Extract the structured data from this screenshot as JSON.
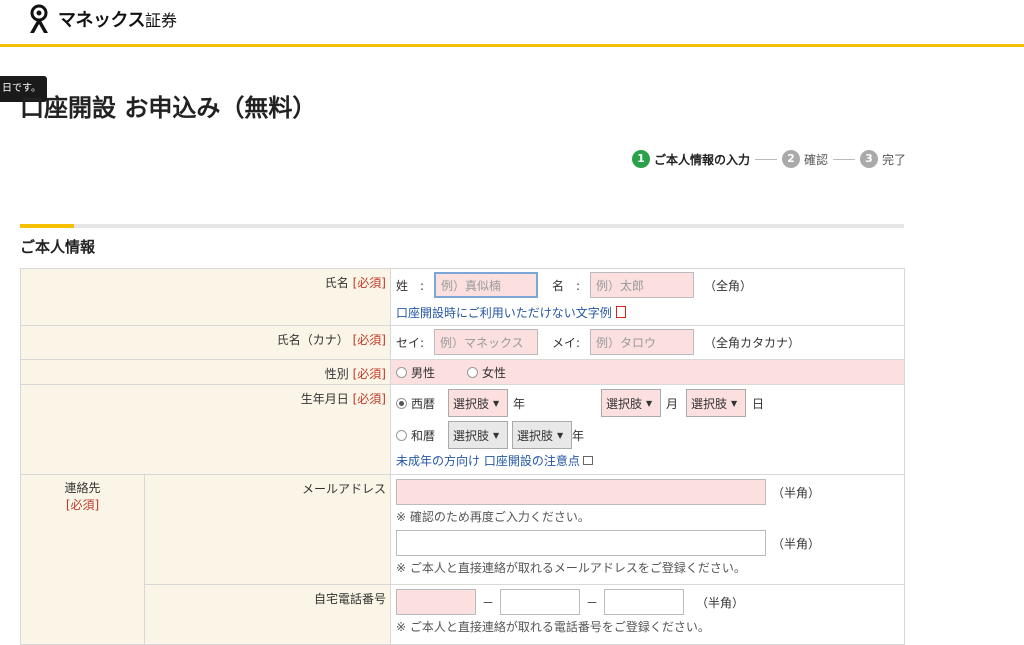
{
  "header": {
    "brand": "マネックス",
    "brand_sub": "証券"
  },
  "tooltip": "日です。",
  "page_title": "口座開設 お申込み（無料）",
  "steps": [
    {
      "num": "1",
      "label": "ご本人情報の入力"
    },
    {
      "num": "2",
      "label": "確認"
    },
    {
      "num": "3",
      "label": "完了"
    }
  ],
  "section_title": "ご本人情報",
  "form": {
    "name": {
      "label": "氏名",
      "required": "[必須]",
      "sei_label": "姓　:",
      "sei_placeholder": "例）真似楠",
      "mei_label": "名　:",
      "mei_placeholder": "例）太郎",
      "note": "（全角）",
      "link": "口座開設時にご利用いただけない文字例"
    },
    "kana": {
      "label": "氏名（カナ）",
      "required": "[必須]",
      "sei_label": "セイ:",
      "sei_placeholder": "例）マネックス",
      "mei_label": "メイ:",
      "mei_placeholder": "例）タロウ",
      "note": "（全角カタカナ）"
    },
    "gender": {
      "label": "性別",
      "required": "[必須]",
      "male": "男性",
      "female": "女性"
    },
    "birth": {
      "label": "生年月日",
      "required": "[必須]",
      "seireki": "西暦",
      "wareki": "和暦",
      "select": "選択肢",
      "year": "年",
      "month": "月",
      "day": "日",
      "link": "未成年の方向け 口座開設の注意点"
    },
    "contact": {
      "label": "連絡先",
      "required": "[必須]",
      "email_label": "メールアドレス",
      "hankaku": "（半角）",
      "email_confirm_note": "※ 確認のため再度ご入力ください。",
      "email_note": "※ ご本人と直接連絡が取れるメールアドレスをご登録ください。",
      "phone_label": "自宅電話番号",
      "dash": "－",
      "phone_note": "※ ご本人と直接連絡が取れる電話番号をご登録ください。"
    }
  },
  "colors": {
    "accent": "#f5c000",
    "step_active": "#2aa24a",
    "required": "#c0392b",
    "link": "#2456a4",
    "error_bg": "#fce0e0",
    "label_bg": "#faf5e6"
  }
}
